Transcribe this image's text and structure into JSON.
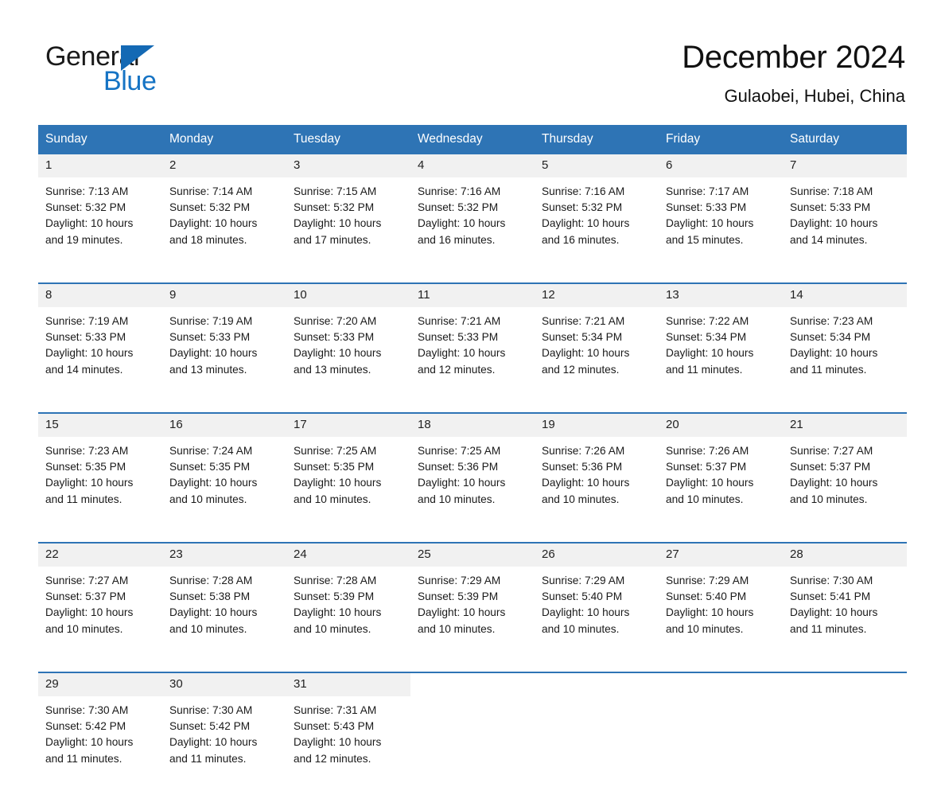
{
  "brand": {
    "name_part1": "General",
    "name_part2": "Blue",
    "triangle_color": "#1469b4",
    "blue_color": "#1573c4"
  },
  "header": {
    "month_title": "December 2024",
    "location": "Gulaobei, Hubei, China"
  },
  "theme": {
    "header_blue": "#2e74b5",
    "daynum_band": "#f1f1f1",
    "text": "#1a1a1a",
    "page_background": "#ffffff"
  },
  "calendar": {
    "weekday_headers": [
      "Sunday",
      "Monday",
      "Tuesday",
      "Wednesday",
      "Thursday",
      "Friday",
      "Saturday"
    ],
    "weeks": [
      [
        {
          "day": "1",
          "sunrise": "Sunrise: 7:13 AM",
          "sunset": "Sunset: 5:32 PM",
          "daylight_l1": "Daylight: 10 hours",
          "daylight_l2": "and 19 minutes."
        },
        {
          "day": "2",
          "sunrise": "Sunrise: 7:14 AM",
          "sunset": "Sunset: 5:32 PM",
          "daylight_l1": "Daylight: 10 hours",
          "daylight_l2": "and 18 minutes."
        },
        {
          "day": "3",
          "sunrise": "Sunrise: 7:15 AM",
          "sunset": "Sunset: 5:32 PM",
          "daylight_l1": "Daylight: 10 hours",
          "daylight_l2": "and 17 minutes."
        },
        {
          "day": "4",
          "sunrise": "Sunrise: 7:16 AM",
          "sunset": "Sunset: 5:32 PM",
          "daylight_l1": "Daylight: 10 hours",
          "daylight_l2": "and 16 minutes."
        },
        {
          "day": "5",
          "sunrise": "Sunrise: 7:16 AM",
          "sunset": "Sunset: 5:32 PM",
          "daylight_l1": "Daylight: 10 hours",
          "daylight_l2": "and 16 minutes."
        },
        {
          "day": "6",
          "sunrise": "Sunrise: 7:17 AM",
          "sunset": "Sunset: 5:33 PM",
          "daylight_l1": "Daylight: 10 hours",
          "daylight_l2": "and 15 minutes."
        },
        {
          "day": "7",
          "sunrise": "Sunrise: 7:18 AM",
          "sunset": "Sunset: 5:33 PM",
          "daylight_l1": "Daylight: 10 hours",
          "daylight_l2": "and 14 minutes."
        }
      ],
      [
        {
          "day": "8",
          "sunrise": "Sunrise: 7:19 AM",
          "sunset": "Sunset: 5:33 PM",
          "daylight_l1": "Daylight: 10 hours",
          "daylight_l2": "and 14 minutes."
        },
        {
          "day": "9",
          "sunrise": "Sunrise: 7:19 AM",
          "sunset": "Sunset: 5:33 PM",
          "daylight_l1": "Daylight: 10 hours",
          "daylight_l2": "and 13 minutes."
        },
        {
          "day": "10",
          "sunrise": "Sunrise: 7:20 AM",
          "sunset": "Sunset: 5:33 PM",
          "daylight_l1": "Daylight: 10 hours",
          "daylight_l2": "and 13 minutes."
        },
        {
          "day": "11",
          "sunrise": "Sunrise: 7:21 AM",
          "sunset": "Sunset: 5:33 PM",
          "daylight_l1": "Daylight: 10 hours",
          "daylight_l2": "and 12 minutes."
        },
        {
          "day": "12",
          "sunrise": "Sunrise: 7:21 AM",
          "sunset": "Sunset: 5:34 PM",
          "daylight_l1": "Daylight: 10 hours",
          "daylight_l2": "and 12 minutes."
        },
        {
          "day": "13",
          "sunrise": "Sunrise: 7:22 AM",
          "sunset": "Sunset: 5:34 PM",
          "daylight_l1": "Daylight: 10 hours",
          "daylight_l2": "and 11 minutes."
        },
        {
          "day": "14",
          "sunrise": "Sunrise: 7:23 AM",
          "sunset": "Sunset: 5:34 PM",
          "daylight_l1": "Daylight: 10 hours",
          "daylight_l2": "and 11 minutes."
        }
      ],
      [
        {
          "day": "15",
          "sunrise": "Sunrise: 7:23 AM",
          "sunset": "Sunset: 5:35 PM",
          "daylight_l1": "Daylight: 10 hours",
          "daylight_l2": "and 11 minutes."
        },
        {
          "day": "16",
          "sunrise": "Sunrise: 7:24 AM",
          "sunset": "Sunset: 5:35 PM",
          "daylight_l1": "Daylight: 10 hours",
          "daylight_l2": "and 10 minutes."
        },
        {
          "day": "17",
          "sunrise": "Sunrise: 7:25 AM",
          "sunset": "Sunset: 5:35 PM",
          "daylight_l1": "Daylight: 10 hours",
          "daylight_l2": "and 10 minutes."
        },
        {
          "day": "18",
          "sunrise": "Sunrise: 7:25 AM",
          "sunset": "Sunset: 5:36 PM",
          "daylight_l1": "Daylight: 10 hours",
          "daylight_l2": "and 10 minutes."
        },
        {
          "day": "19",
          "sunrise": "Sunrise: 7:26 AM",
          "sunset": "Sunset: 5:36 PM",
          "daylight_l1": "Daylight: 10 hours",
          "daylight_l2": "and 10 minutes."
        },
        {
          "day": "20",
          "sunrise": "Sunrise: 7:26 AM",
          "sunset": "Sunset: 5:37 PM",
          "daylight_l1": "Daylight: 10 hours",
          "daylight_l2": "and 10 minutes."
        },
        {
          "day": "21",
          "sunrise": "Sunrise: 7:27 AM",
          "sunset": "Sunset: 5:37 PM",
          "daylight_l1": "Daylight: 10 hours",
          "daylight_l2": "and 10 minutes."
        }
      ],
      [
        {
          "day": "22",
          "sunrise": "Sunrise: 7:27 AM",
          "sunset": "Sunset: 5:37 PM",
          "daylight_l1": "Daylight: 10 hours",
          "daylight_l2": "and 10 minutes."
        },
        {
          "day": "23",
          "sunrise": "Sunrise: 7:28 AM",
          "sunset": "Sunset: 5:38 PM",
          "daylight_l1": "Daylight: 10 hours",
          "daylight_l2": "and 10 minutes."
        },
        {
          "day": "24",
          "sunrise": "Sunrise: 7:28 AM",
          "sunset": "Sunset: 5:39 PM",
          "daylight_l1": "Daylight: 10 hours",
          "daylight_l2": "and 10 minutes."
        },
        {
          "day": "25",
          "sunrise": "Sunrise: 7:29 AM",
          "sunset": "Sunset: 5:39 PM",
          "daylight_l1": "Daylight: 10 hours",
          "daylight_l2": "and 10 minutes."
        },
        {
          "day": "26",
          "sunrise": "Sunrise: 7:29 AM",
          "sunset": "Sunset: 5:40 PM",
          "daylight_l1": "Daylight: 10 hours",
          "daylight_l2": "and 10 minutes."
        },
        {
          "day": "27",
          "sunrise": "Sunrise: 7:29 AM",
          "sunset": "Sunset: 5:40 PM",
          "daylight_l1": "Daylight: 10 hours",
          "daylight_l2": "and 10 minutes."
        },
        {
          "day": "28",
          "sunrise": "Sunrise: 7:30 AM",
          "sunset": "Sunset: 5:41 PM",
          "daylight_l1": "Daylight: 10 hours",
          "daylight_l2": "and 11 minutes."
        }
      ],
      [
        {
          "day": "29",
          "sunrise": "Sunrise: 7:30 AM",
          "sunset": "Sunset: 5:42 PM",
          "daylight_l1": "Daylight: 10 hours",
          "daylight_l2": "and 11 minutes."
        },
        {
          "day": "30",
          "sunrise": "Sunrise: 7:30 AM",
          "sunset": "Sunset: 5:42 PM",
          "daylight_l1": "Daylight: 10 hours",
          "daylight_l2": "and 11 minutes."
        },
        {
          "day": "31",
          "sunrise": "Sunrise: 7:31 AM",
          "sunset": "Sunset: 5:43 PM",
          "daylight_l1": "Daylight: 10 hours",
          "daylight_l2": "and 12 minutes."
        },
        {
          "day": "",
          "sunrise": "",
          "sunset": "",
          "daylight_l1": "",
          "daylight_l2": ""
        },
        {
          "day": "",
          "sunrise": "",
          "sunset": "",
          "daylight_l1": "",
          "daylight_l2": ""
        },
        {
          "day": "",
          "sunrise": "",
          "sunset": "",
          "daylight_l1": "",
          "daylight_l2": ""
        },
        {
          "day": "",
          "sunrise": "",
          "sunset": "",
          "daylight_l1": "",
          "daylight_l2": ""
        }
      ]
    ]
  }
}
